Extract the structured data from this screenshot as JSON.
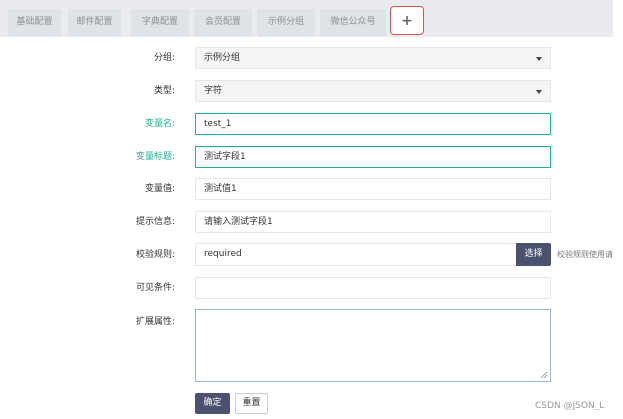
{
  "tabs": [
    {
      "label": "基础配置"
    },
    {
      "label": "邮件配置"
    },
    {
      "label": "字典配置"
    },
    {
      "label": "会员配置"
    },
    {
      "label": "示例分组"
    },
    {
      "label": "微信公众号"
    }
  ],
  "add_tab_label": "+",
  "form": {
    "group": {
      "label": "分组:",
      "value": "示例分组"
    },
    "type": {
      "label": "类型:",
      "value": "字符"
    },
    "var_name": {
      "label": "变量名:",
      "value": "test_1"
    },
    "var_title": {
      "label": "变量标题:",
      "value": "测试字段1"
    },
    "var_value": {
      "label": "变量值:",
      "value": "测试值1"
    },
    "tip": {
      "label": "提示信息:",
      "value": "请输入测试字段1"
    },
    "rule": {
      "label": "校验规则:",
      "value": "required",
      "button": "选择",
      "hint": "校验规则使用请"
    },
    "visible": {
      "label": "可见条件:",
      "value": ""
    },
    "extend": {
      "label": "扩展属性:",
      "value": ""
    }
  },
  "actions": {
    "confirm": "确定",
    "reset": "重置"
  },
  "watermark": "CSDN @JSON_L",
  "colors": {
    "accent_teal": "#1ab394",
    "button_dark": "#4b5270",
    "add_tab_border": "#d9534f"
  }
}
